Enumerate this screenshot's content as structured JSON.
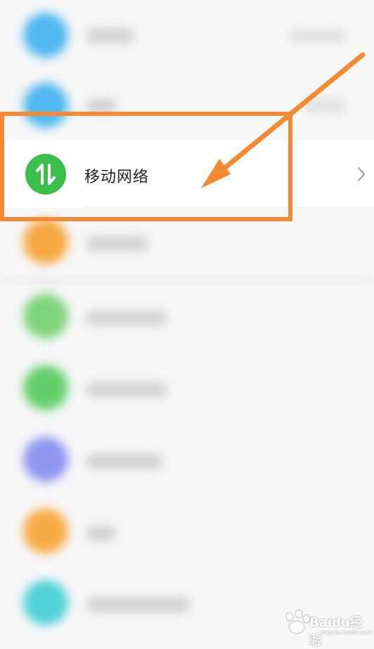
{
  "settings_list": {
    "focused_item": {
      "label": "移动网络",
      "icon": "mobile-data-arrows-icon",
      "icon_color": "#3bbf4a",
      "chevron": "chevron-right-icon"
    },
    "blurred_icon_colors": [
      "#4fb8ef",
      "#4fb8ef",
      "#f6a843",
      "#7fd47a",
      "#63cf6a",
      "#8f96f0",
      "#f7ab45",
      "#4fd2d8"
    ]
  },
  "annotation": {
    "highlight_color": "#f28a35",
    "arrow": "pointing-arrow"
  },
  "watermark": {
    "brand": "Baidu经验",
    "url": "jingyan.baidu.com"
  }
}
